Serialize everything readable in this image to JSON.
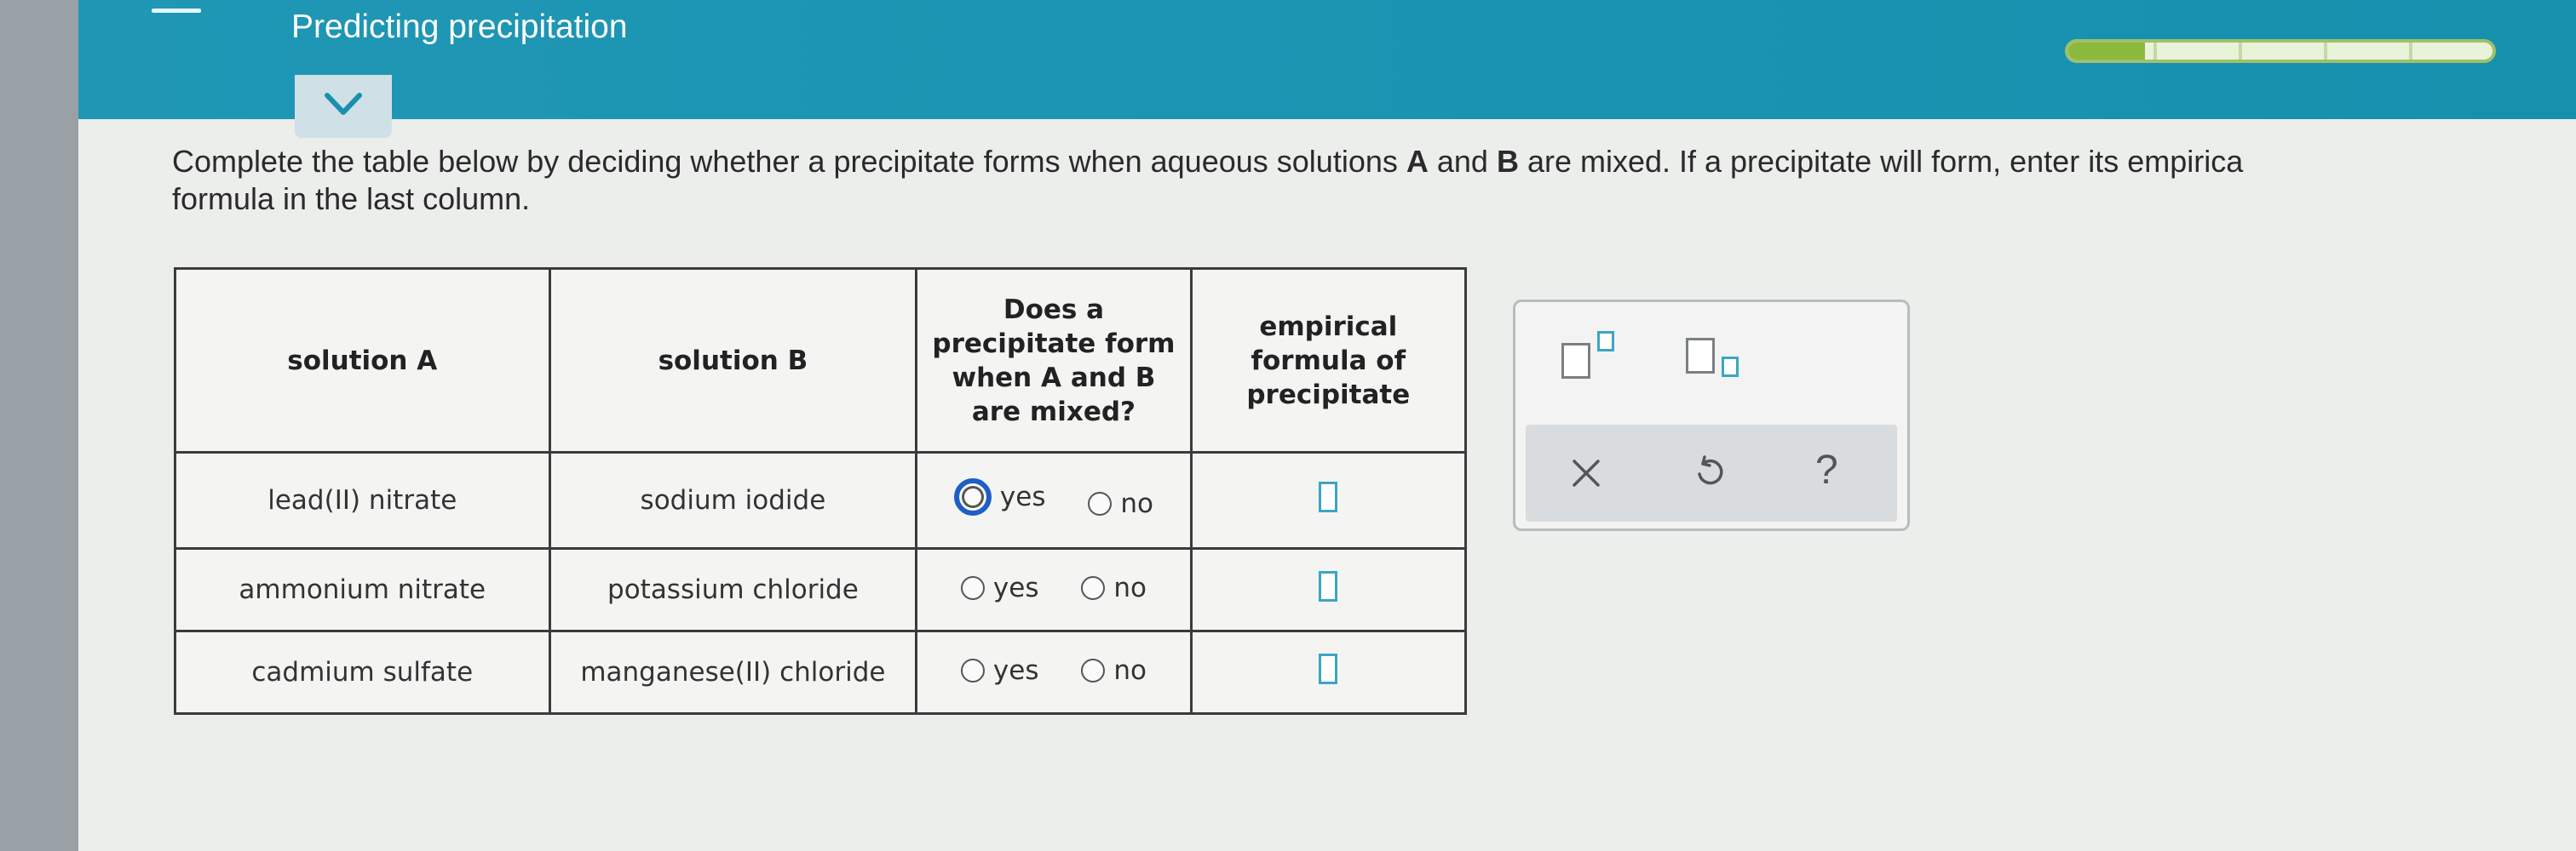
{
  "header": {
    "title": "Predicting precipitation",
    "progress": 0.18
  },
  "instructions": {
    "part1": "Complete the table below by deciding whether a precipitate forms when aqueous solutions ",
    "bold_a": "A",
    "and": " and ",
    "bold_b": "B",
    "part2": " are mixed. If a precipitate will form, enter its empirica",
    "line2": "formula in the last column."
  },
  "table": {
    "headers": {
      "solution_a": "solution A",
      "solution_b": "solution B",
      "does_precipitate_line1": "Does a",
      "does_precipitate_line2": "precipitate form",
      "does_precipitate_line3": "when A and B",
      "does_precipitate_line4": "are mixed?",
      "formula_line1": "empirical",
      "formula_line2": "formula of",
      "formula_line3": "precipitate"
    },
    "rows": [
      {
        "solution_a": "lead(II) nitrate",
        "solution_b": "sodium iodide",
        "yes": "yes",
        "no": "no"
      },
      {
        "solution_a": "ammonium nitrate",
        "solution_b": "potassium chloride",
        "yes": "yes",
        "no": "no"
      },
      {
        "solution_a": "cadmium sulfate",
        "solution_b": "manganese(II) chloride",
        "yes": "yes",
        "no": "no"
      }
    ]
  },
  "toolbox": {
    "icons": [
      "superscript-icon",
      "subscript-icon",
      "clear-icon",
      "undo-icon",
      "help-icon"
    ],
    "help_glyph": "?"
  },
  "colors": {
    "header_bg": "#1f97b5",
    "accent": "#3aa6c4",
    "focus_ring": "#1d5fc4",
    "progress_fill": "#8cb83e"
  }
}
